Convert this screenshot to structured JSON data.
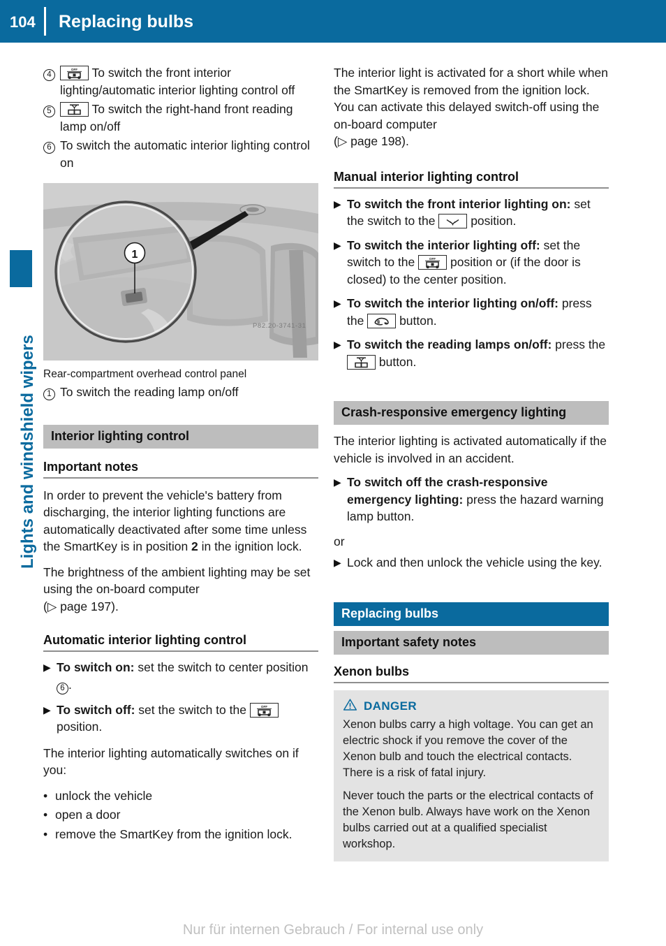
{
  "header": {
    "page_number": "104",
    "title": "Replacing bulbs"
  },
  "side_tab": {
    "label": "Lights and windshield wipers",
    "color": "#0a6a9e"
  },
  "left_column": {
    "callouts": [
      {
        "num": "4",
        "icon": "interior-lighting-off-icon",
        "text": "To switch the front interior lighting/automatic interior lighting control off"
      },
      {
        "num": "5",
        "icon": "reading-lamp-icon",
        "text": "To switch the right-hand front reading lamp on/off"
      },
      {
        "num": "6",
        "icon": "",
        "text": "To switch the automatic interior lighting control on"
      }
    ],
    "figure": {
      "alt": "Rear-compartment overhead control panel photo with magnified detail circle",
      "watermark": "P82.20-3741-31",
      "marker": "1"
    },
    "figure_caption": "Rear-compartment overhead control panel",
    "figure_callouts": [
      {
        "num": "1",
        "text": "To switch the reading lamp on/off"
      }
    ],
    "section_bar": "Interior lighting control",
    "important_notes_heading": "Important notes",
    "important_notes": [
      "In order to prevent the vehicle's battery from discharging, the interior lighting functions are automatically deactivated after some time unless the SmartKey is in position 2 in the ignition lock.",
      "The brightness of the ambient lighting may be set using the on-board computer (▷ page 197)."
    ],
    "notes_para1_pre": "In order to prevent the vehicle's battery from discharging, the interior lighting functions are automatically deactivated after some time unless the SmartKey is in position ",
    "notes_para1_bold": "2",
    "notes_para1_post": " in the ignition lock.",
    "notes_para2_pre": "The brightness of the ambient lighting may be set using the on-board computer",
    "notes_para2_ref": "page 197",
    "auto_heading": "Automatic interior lighting control",
    "auto_items": [
      {
        "bold": "To switch on:",
        "rest": " set the switch to center position ",
        "circ": "6",
        "tail": "."
      },
      {
        "bold": "To switch off:",
        "rest": " set the switch to the ",
        "icon": "interior-lighting-off-icon",
        "tail": " position."
      }
    ],
    "auto_lead": "The interior lighting automatically switches on if you:",
    "auto_bullets": [
      "unlock the vehicle",
      "open a door",
      "remove the SmartKey from the ignition lock."
    ]
  },
  "right_column": {
    "intro_pre": "The interior light is activated for a short while when the SmartKey is removed from the ignition lock. You can activate this delayed switch-off using the on-board computer",
    "intro_ref": "page 198",
    "manual_heading": "Manual interior lighting control",
    "manual_items": [
      {
        "bold": "To switch the front interior lighting on:",
        "rest": " set the switch to the ",
        "icon": "interior-lighting-on-icon",
        "tail": " position."
      },
      {
        "bold": "To switch the interior lighting off:",
        "rest": " set the switch to the ",
        "icon": "interior-lighting-off-icon",
        "tail": " position or (if the door is closed) to the center position."
      },
      {
        "bold": "To switch the interior lighting on/off:",
        "rest": " press the ",
        "icon": "interior-light-button-icon",
        "tail": " button."
      },
      {
        "bold": "To switch the reading lamps on/off:",
        "rest": " press the ",
        "icon": "reading-lamp-icon",
        "tail": " button."
      }
    ],
    "crash_bar": "Crash-responsive emergency lighting",
    "crash_intro": "The interior lighting is activated automatically if the vehicle is involved in an accident.",
    "crash_items": [
      {
        "bold": "To switch off the crash-responsive emergency lighting:",
        "rest": " press the hazard warning lamp button."
      }
    ],
    "crash_or": "or",
    "crash_items2": [
      {
        "bold": "",
        "rest": "Lock and then unlock the vehicle using the key."
      }
    ],
    "replacing_bar": "Replacing bulbs",
    "safety_bar": "Important safety notes",
    "xenon_heading": "Xenon bulbs",
    "danger": {
      "label": "DANGER",
      "icon": "warning-triangle-icon",
      "color": "#0a6a9e",
      "paragraphs": [
        "Xenon bulbs carry a high voltage. You can get an electric shock if you remove the cover of the Xenon bulb and touch the electrical contacts. There is a risk of fatal injury.",
        "Never touch the parts or the electrical contacts of the Xenon bulb. Always have work on the Xenon bulbs carried out at a qualified specialist workshop."
      ]
    }
  },
  "footer": {
    "text": "Nur für internen Gebrauch / For internal use only"
  }
}
